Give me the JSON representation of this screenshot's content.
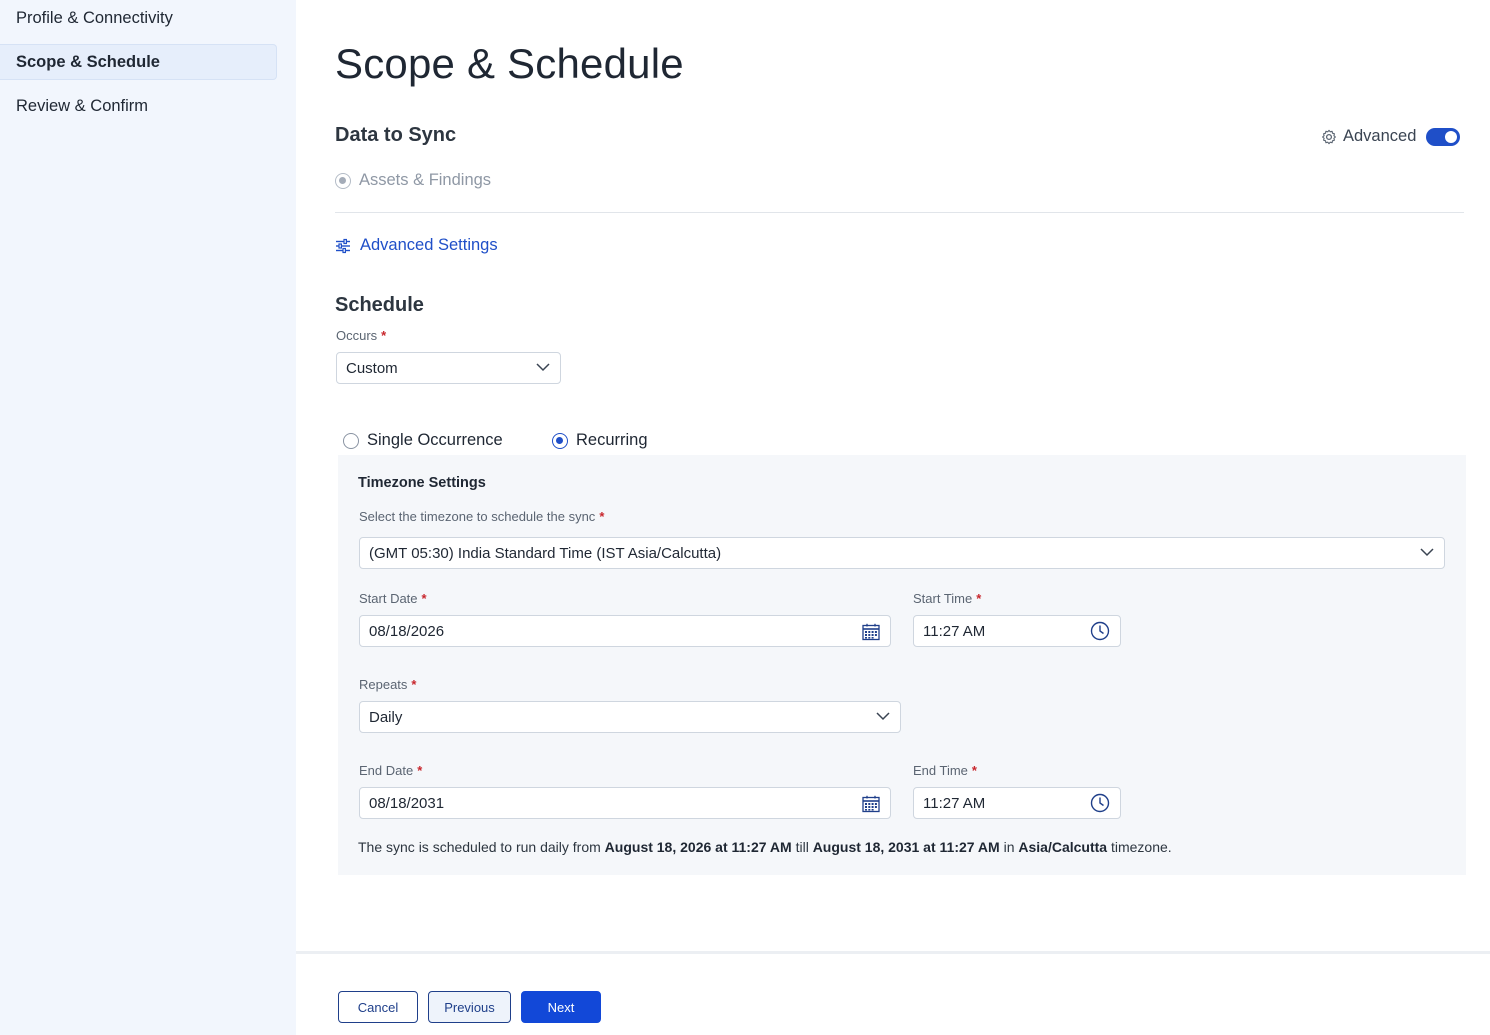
{
  "sidebar": {
    "items": [
      {
        "label": "Profile & Connectivity"
      },
      {
        "label": "Scope & Schedule"
      },
      {
        "label": "Review & Confirm"
      }
    ]
  },
  "page": {
    "title": "Scope & Schedule"
  },
  "data_to_sync": {
    "title": "Data to Sync",
    "advanced_label": "Advanced",
    "advanced_enabled": true,
    "option_label": "Assets & Findings",
    "advanced_settings_link": "Advanced Settings"
  },
  "schedule": {
    "title": "Schedule",
    "occurs_label": "Occurs",
    "occurs_value": "Custom",
    "single_label": "Single Occurrence",
    "recurring_label": "Recurring",
    "selected_mode": "Recurring"
  },
  "timezone": {
    "title": "Timezone Settings",
    "select_label": "Select the timezone to schedule the sync",
    "value": "(GMT 05:30) India Standard Time (IST Asia/Calcutta)",
    "start_date_label": "Start Date",
    "start_date": "08/18/2026",
    "start_time_label": "Start Time",
    "start_time": "11:27 AM",
    "repeats_label": "Repeats",
    "repeats_value": "Daily",
    "end_date_label": "End Date",
    "end_date": "08/18/2031",
    "end_time_label": "End Time",
    "end_time": "11:27 AM",
    "summary": {
      "prefix": "The sync is scheduled to run daily from ",
      "start": "August 18, 2026 at 11:27 AM",
      "mid": " till ",
      "end": "August 18, 2031 at 11:27 AM",
      "mid2": " in ",
      "tz": "Asia/Calcutta",
      "suffix": " timezone."
    }
  },
  "footer": {
    "cancel": "Cancel",
    "previous": "Previous",
    "next": "Next"
  },
  "colors": {
    "accent": "#1248d8",
    "required": "#c8262c",
    "sidebar_bg": "#f2f6fd"
  }
}
